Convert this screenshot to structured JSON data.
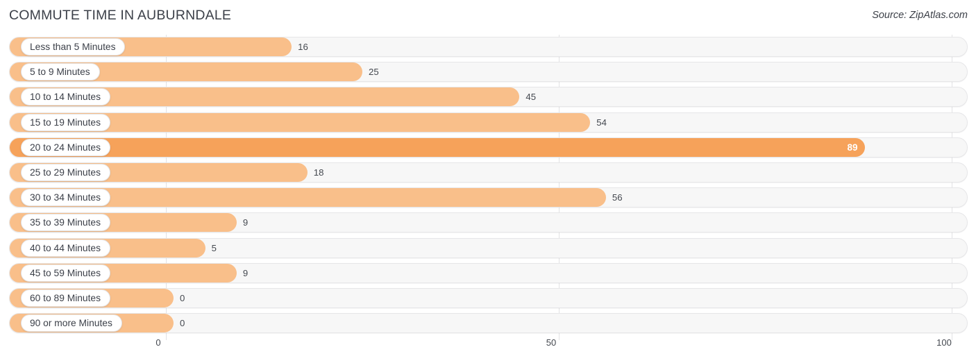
{
  "header": {
    "title": "COMMUTE TIME IN AUBURNDALE",
    "source": "Source: ZipAtlas.com"
  },
  "colors": {
    "bar": "#f9bf8a",
    "bar_accent": "#f6a25a",
    "track": "#f7f7f7",
    "gridline": "#e2e2e4",
    "text": "#3c4049"
  },
  "chart_data": {
    "type": "bar",
    "orientation": "horizontal",
    "title": "COMMUTE TIME IN AUBURNDALE",
    "xlabel": "",
    "ylabel": "",
    "xlim": [
      0,
      100
    ],
    "grid": true,
    "legend": false,
    "ticks": [
      "0",
      "50",
      "100"
    ],
    "tick_values": [
      0,
      50,
      100
    ],
    "categories": [
      "Less than 5 Minutes",
      "5 to 9 Minutes",
      "10 to 14 Minutes",
      "15 to 19 Minutes",
      "20 to 24 Minutes",
      "25 to 29 Minutes",
      "30 to 34 Minutes",
      "35 to 39 Minutes",
      "40 to 44 Minutes",
      "45 to 59 Minutes",
      "60 to 89 Minutes",
      "90 or more Minutes"
    ],
    "values": [
      16,
      25,
      45,
      54,
      89,
      18,
      56,
      9,
      5,
      9,
      0,
      0
    ],
    "value_labels": [
      "16",
      "25",
      "45",
      "54",
      "89",
      "18",
      "56",
      "9",
      "5",
      "9",
      "0",
      "0"
    ],
    "highlight_index": 4
  },
  "rows": [
    {
      "label": "Less than 5 Minutes",
      "value": 16,
      "display": "16",
      "accent": false
    },
    {
      "label": "5 to 9 Minutes",
      "value": 25,
      "display": "25",
      "accent": false
    },
    {
      "label": "10 to 14 Minutes",
      "value": 45,
      "display": "45",
      "accent": false
    },
    {
      "label": "15 to 19 Minutes",
      "value": 54,
      "display": "54",
      "accent": false
    },
    {
      "label": "20 to 24 Minutes",
      "value": 89,
      "display": "89",
      "accent": true
    },
    {
      "label": "25 to 29 Minutes",
      "value": 18,
      "display": "18",
      "accent": false
    },
    {
      "label": "30 to 34 Minutes",
      "value": 56,
      "display": "56",
      "accent": false
    },
    {
      "label": "35 to 39 Minutes",
      "value": 9,
      "display": "9",
      "accent": false
    },
    {
      "label": "40 to 44 Minutes",
      "value": 5,
      "display": "5",
      "accent": false
    },
    {
      "label": "45 to 59 Minutes",
      "value": 9,
      "display": "9",
      "accent": false
    },
    {
      "label": "60 to 89 Minutes",
      "value": 0,
      "display": "0",
      "accent": false
    },
    {
      "label": "90 or more Minutes",
      "value": 0,
      "display": "0",
      "accent": false
    }
  ],
  "axis": {
    "labels": [
      "0",
      "50",
      "100"
    ],
    "values": [
      0,
      50,
      100
    ]
  }
}
